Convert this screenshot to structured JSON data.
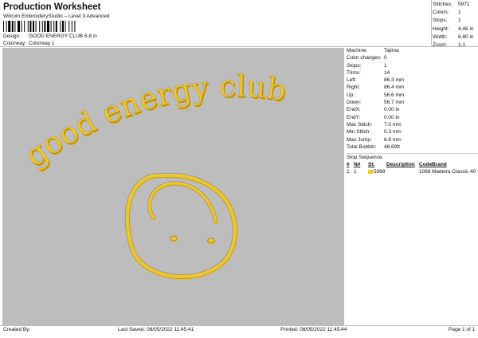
{
  "header": {
    "title": "Production Worksheet",
    "subtitle": "Wilcom EmbroideryStudio – Level 3 Advanced",
    "design_label": "Design:",
    "design_value": "GOOD ENERGY CLUB 6,8 in",
    "colorway_label": "Colorway:",
    "colorway_value": "Colorway 1"
  },
  "top_stats": [
    {
      "label": "Stitches:",
      "value": "5971"
    },
    {
      "label": "Colors:",
      "value": "1"
    },
    {
      "label": "Stops:",
      "value": "1"
    },
    {
      "label": "Height:",
      "value": "4.46 in"
    },
    {
      "label": "Width:",
      "value": "6.80 in"
    },
    {
      "label": "Zoom:",
      "value": "1:1"
    }
  ],
  "design": {
    "text": "good energy club",
    "thread_color": "#e8c63a",
    "thread_shadow": "#b8901a",
    "background_color": "#bdbdbd"
  },
  "machine_info": [
    {
      "label": "Machine:",
      "value": "Tajima"
    },
    {
      "label": "Color changes:",
      "value": "0"
    },
    {
      "label": "Stops:",
      "value": "1"
    },
    {
      "label": "Trims:",
      "value": "14"
    },
    {
      "label": "Left:",
      "value": "86.3 mm"
    },
    {
      "label": "Right:",
      "value": "86.4 mm"
    },
    {
      "label": "Up:",
      "value": "56.6 mm"
    },
    {
      "label": "Down:",
      "value": "56.7 mm"
    },
    {
      "label": "EndX:",
      "value": "0.00 in"
    },
    {
      "label": "EndY:",
      "value": "0.00 in"
    },
    {
      "label": "Max Stitch:",
      "value": "7.0 mm"
    },
    {
      "label": "Min Stitch:",
      "value": "0.3 mm"
    },
    {
      "label": "Max Jump:",
      "value": "6.8 mm"
    },
    {
      "label": "Total Bobbin:",
      "value": "48.69ft"
    }
  ],
  "stop_sequence": {
    "title": "Stop Sequence:",
    "headers": [
      "#",
      "N#",
      "St.",
      "Description",
      "Code",
      "Brand"
    ],
    "rows": [
      {
        "num": "1.",
        "n": "1",
        "st": "5969",
        "description": "",
        "code": "1068",
        "brand": "Madeira Classic 40",
        "color": "#e8c63a"
      }
    ]
  },
  "footer": {
    "created_by": "Created By:",
    "last_saved": "Last Saved: 08/05/2022 11:45:41",
    "printed": "Printed: 08/05/2022 11:45:44",
    "page": "Page 1 of 1"
  }
}
